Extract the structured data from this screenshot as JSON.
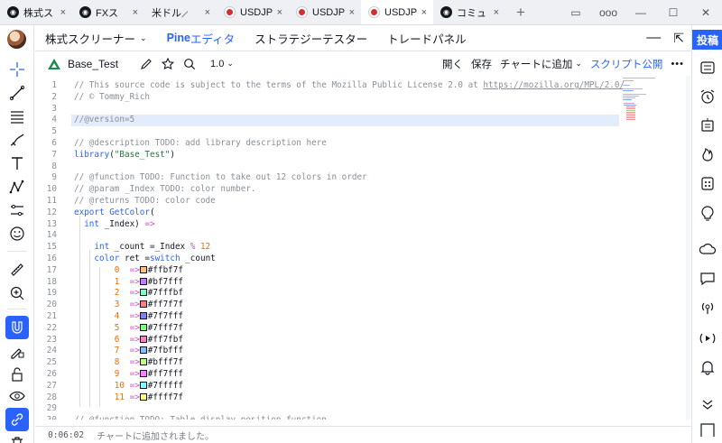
{
  "tabs": [
    {
      "label": "株式ス",
      "icon": "tradingview-icon",
      "active": false
    },
    {
      "label": "FXス",
      "icon": "tradingview-icon",
      "active": false
    },
    {
      "label": "米ドル／円",
      "icon": "none",
      "active": false
    },
    {
      "label": "USDJP",
      "icon": "flag-icon",
      "active": false
    },
    {
      "label": "USDJP",
      "icon": "flag-icon",
      "active": false
    },
    {
      "label": "USDJP",
      "icon": "flag-icon",
      "active": true
    },
    {
      "label": "コミュ",
      "icon": "tradingview-icon",
      "active": false
    }
  ],
  "window": {
    "close_glyph": "×",
    "new_tab": "+",
    "more": "ooo",
    "minimize": "—",
    "maximize": "☐",
    "close": "✕"
  },
  "panel": {
    "tab_screener": "株式スクリーナー",
    "tab_pine_prefix": "Pine",
    "tab_pine_suffix": " エディタ",
    "tab_strategy": "ストラテジーテスター",
    "tab_trade": "トレードパネル"
  },
  "script": {
    "name": "Base_Test",
    "version": "1.0",
    "open": "開く",
    "save": "保存",
    "add_to_chart": "チャートに追加",
    "publish": "スクリプト公開"
  },
  "right": {
    "post": "投稿"
  },
  "status": {
    "time": "0:06:02",
    "message": "チャートに追加されました。"
  },
  "colors": {
    "accent": "#2962ff",
    "comment": "#8a8f98",
    "string": "#1e7a3d",
    "number": "#ef6c00"
  },
  "code": {
    "lines": [
      {
        "n": "1",
        "parts": [
          [
            "cm",
            "// This source code is subject to the terms of the Mozilla Public License 2.0 at "
          ],
          [
            "u",
            "https://mozilla.org/MPL/2.0/"
          ]
        ]
      },
      {
        "n": "2",
        "parts": [
          [
            "cm",
            "// © Tommy_Rich"
          ]
        ]
      },
      {
        "n": "3",
        "parts": []
      },
      {
        "n": "4",
        "parts": [
          [
            "cm",
            "//@version=5"
          ]
        ],
        "hl": true
      },
      {
        "n": "5",
        "parts": []
      },
      {
        "n": "6",
        "parts": [
          [
            "cm",
            "// "
          ],
          [
            "tag",
            "@description"
          ],
          [
            "cm",
            " TODO: add library description here"
          ]
        ]
      },
      {
        "n": "7",
        "parts": [
          [
            "fn",
            "library"
          ],
          [
            "plain",
            "("
          ],
          [
            "str",
            "\"Base_Test\""
          ],
          [
            "plain",
            ")"
          ]
        ]
      },
      {
        "n": "8",
        "parts": []
      },
      {
        "n": "9",
        "parts": [
          [
            "cm",
            "// "
          ],
          [
            "tag",
            "@function"
          ],
          [
            "cm",
            " TODO: Function to take out 12 colors in order"
          ]
        ]
      },
      {
        "n": "10",
        "parts": [
          [
            "cm",
            "// "
          ],
          [
            "tag",
            "@param"
          ],
          [
            "cm",
            " _Index TODO: color number."
          ]
        ]
      },
      {
        "n": "11",
        "parts": [
          [
            "cm",
            "// "
          ],
          [
            "tag",
            "@returns"
          ],
          [
            "cm",
            " TODO: color code"
          ]
        ]
      },
      {
        "n": "12",
        "parts": [
          [
            "kw",
            "export "
          ],
          [
            "fn",
            "GetColor"
          ],
          [
            "plain",
            "("
          ]
        ]
      },
      {
        "n": "13",
        "parts": [
          [
            "plain",
            "  "
          ],
          [
            "kw",
            "int"
          ],
          [
            "plain",
            " _Index) "
          ],
          [
            "op",
            "=>"
          ]
        ]
      },
      {
        "n": "14",
        "parts": []
      },
      {
        "n": "15",
        "parts": [
          [
            "plain",
            "    "
          ],
          [
            "kw",
            "int"
          ],
          [
            "plain",
            " _count ="
          ],
          [
            "plain",
            "_Index "
          ],
          [
            "op",
            "%"
          ],
          [
            "num",
            " 12"
          ]
        ]
      },
      {
        "n": "16",
        "parts": [
          [
            "plain",
            "    "
          ],
          [
            "kw",
            "color"
          ],
          [
            "plain",
            " ret ="
          ],
          [
            "kw",
            "switch"
          ],
          [
            "plain",
            " _count"
          ]
        ]
      },
      {
        "n": "17",
        "parts": [
          [
            "plain",
            "        "
          ],
          [
            "num",
            "0"
          ],
          [
            "plain",
            "  "
          ],
          [
            "op",
            "=>"
          ],
          [
            "sw",
            "#ffbf7f"
          ],
          [
            "plain",
            "#ffbf7f"
          ]
        ]
      },
      {
        "n": "18",
        "parts": [
          [
            "plain",
            "        "
          ],
          [
            "num",
            "1"
          ],
          [
            "plain",
            "  "
          ],
          [
            "op",
            "=>"
          ],
          [
            "sw",
            "#bf7fff"
          ],
          [
            "plain",
            "#bf7fff"
          ]
        ]
      },
      {
        "n": "19",
        "parts": [
          [
            "plain",
            "        "
          ],
          [
            "num",
            "2"
          ],
          [
            "plain",
            "  "
          ],
          [
            "op",
            "=>"
          ],
          [
            "sw",
            "#7fffbf"
          ],
          [
            "plain",
            "#7fffbf"
          ]
        ]
      },
      {
        "n": "20",
        "parts": [
          [
            "plain",
            "        "
          ],
          [
            "num",
            "3"
          ],
          [
            "plain",
            "  "
          ],
          [
            "op",
            "=>"
          ],
          [
            "sw",
            "#ff7f7f"
          ],
          [
            "plain",
            "#ff7f7f"
          ]
        ]
      },
      {
        "n": "21",
        "parts": [
          [
            "plain",
            "        "
          ],
          [
            "num",
            "4"
          ],
          [
            "plain",
            "  "
          ],
          [
            "op",
            "=>"
          ],
          [
            "sw",
            "#7f7fff"
          ],
          [
            "plain",
            "#7f7fff"
          ]
        ]
      },
      {
        "n": "22",
        "parts": [
          [
            "plain",
            "        "
          ],
          [
            "num",
            "5"
          ],
          [
            "plain",
            "  "
          ],
          [
            "op",
            "=>"
          ],
          [
            "sw",
            "#7fff7f"
          ],
          [
            "plain",
            "#7fff7f"
          ]
        ]
      },
      {
        "n": "23",
        "parts": [
          [
            "plain",
            "        "
          ],
          [
            "num",
            "6"
          ],
          [
            "plain",
            "  "
          ],
          [
            "op",
            "=>"
          ],
          [
            "sw",
            "#ff7fbf"
          ],
          [
            "plain",
            "#ff7fbf"
          ]
        ]
      },
      {
        "n": "24",
        "parts": [
          [
            "plain",
            "        "
          ],
          [
            "num",
            "7"
          ],
          [
            "plain",
            "  "
          ],
          [
            "op",
            "=>"
          ],
          [
            "sw",
            "#7fbfff"
          ],
          [
            "plain",
            "#7fbfff"
          ]
        ]
      },
      {
        "n": "25",
        "parts": [
          [
            "plain",
            "        "
          ],
          [
            "num",
            "8"
          ],
          [
            "plain",
            "  "
          ],
          [
            "op",
            "=>"
          ],
          [
            "sw",
            "#bfff7f"
          ],
          [
            "plain",
            "#bfff7f"
          ]
        ]
      },
      {
        "n": "26",
        "parts": [
          [
            "plain",
            "        "
          ],
          [
            "num",
            "9"
          ],
          [
            "plain",
            "  "
          ],
          [
            "op",
            "=>"
          ],
          [
            "sw",
            "#ff7fff"
          ],
          [
            "plain",
            "#ff7fff"
          ]
        ]
      },
      {
        "n": "27",
        "parts": [
          [
            "plain",
            "        "
          ],
          [
            "num",
            "10"
          ],
          [
            "plain",
            " "
          ],
          [
            "op",
            "=>"
          ],
          [
            "sw",
            "#7fffff"
          ],
          [
            "plain",
            "#7fffff"
          ]
        ]
      },
      {
        "n": "28",
        "parts": [
          [
            "plain",
            "        "
          ],
          [
            "num",
            "11"
          ],
          [
            "plain",
            " "
          ],
          [
            "op",
            "=>"
          ],
          [
            "sw",
            "#ffff7f"
          ],
          [
            "plain",
            "#ffff7f"
          ]
        ]
      },
      {
        "n": "29",
        "parts": []
      },
      {
        "n": "30",
        "parts": [
          [
            "cm",
            "// @function TODO: Table display position function"
          ]
        ]
      }
    ]
  }
}
